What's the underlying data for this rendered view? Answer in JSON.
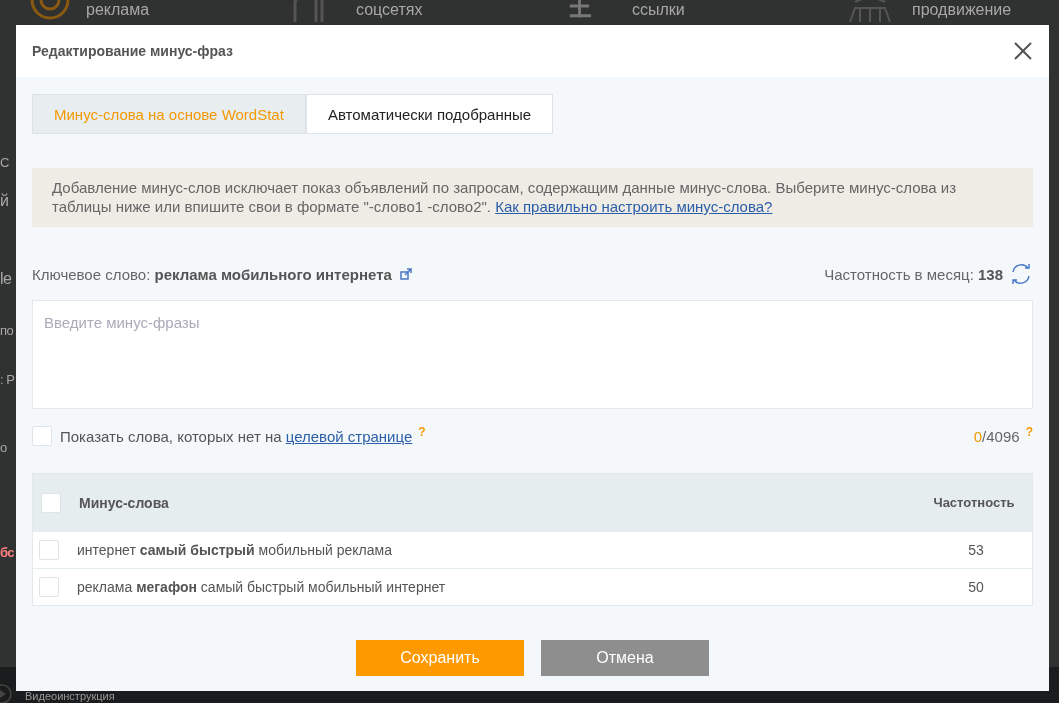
{
  "background": {
    "top_links": [
      {
        "label": "реклама",
        "kind": "target"
      },
      {
        "label": "соцсетях",
        "kind": "social"
      },
      {
        "label": "ссылки",
        "kind": "links"
      },
      {
        "label": "продвижение",
        "kind": "growth"
      }
    ],
    "side_fragments": [
      {
        "text": "С",
        "kind": "plain"
      },
      {
        "text": "й",
        "kind": "large"
      },
      {
        "text": "le",
        "kind": "large"
      },
      {
        "text": "по",
        "kind": "plain"
      },
      {
        "text": ": Р",
        "kind": "plain"
      },
      {
        "text": "о",
        "kind": "plain"
      },
      {
        "text": "бс",
        "kind": "alert"
      }
    ],
    "footer_link": "Видеоинструкция"
  },
  "dialog": {
    "title": "Редактирование минус-фраз",
    "tabs": [
      {
        "label": "Минус-слова на основе WordStat",
        "selected": true
      },
      {
        "label": "Автоматически подобранные",
        "selected": false
      }
    ],
    "notice": {
      "text": "Добавление минус-слов исключает показ объявлений по запросам, содержащим данные минус-слова. Выберите минус-слова из таблицы ниже или впишите свои в формате \"-слово1 -слово2\".",
      "link": "Как правильно настроить минус-слова?"
    },
    "keyword": {
      "label": "Ключевое слово:",
      "value": "реклама мобильного интернета"
    },
    "frequency": {
      "label": "Частотность в месяц:",
      "value": "138"
    },
    "phrases_field": {
      "placeholder": "Введите минус-фразы"
    },
    "show_missing": {
      "label": "Показать слова, которых нет на",
      "link": "целевой странице",
      "hint": "?",
      "checked": false
    },
    "counter": {
      "used": "0",
      "limit": "/4096",
      "hint": "?"
    },
    "table": {
      "columns": [
        "Минус-слова",
        "Частотность"
      ],
      "all_checked": false,
      "rows": [
        {
          "phrase": "интернет **самый быстрый** мобильный реклама",
          "frequency": "53",
          "checked": false
        },
        {
          "phrase": "реклама **мегафон** самый быстрый мобильный интернет",
          "frequency": "50",
          "checked": false
        }
      ]
    },
    "buttons": [
      {
        "label": "Сохранить",
        "kind": "primary"
      },
      {
        "label": "Отмена",
        "kind": "secondary"
      }
    ]
  }
}
